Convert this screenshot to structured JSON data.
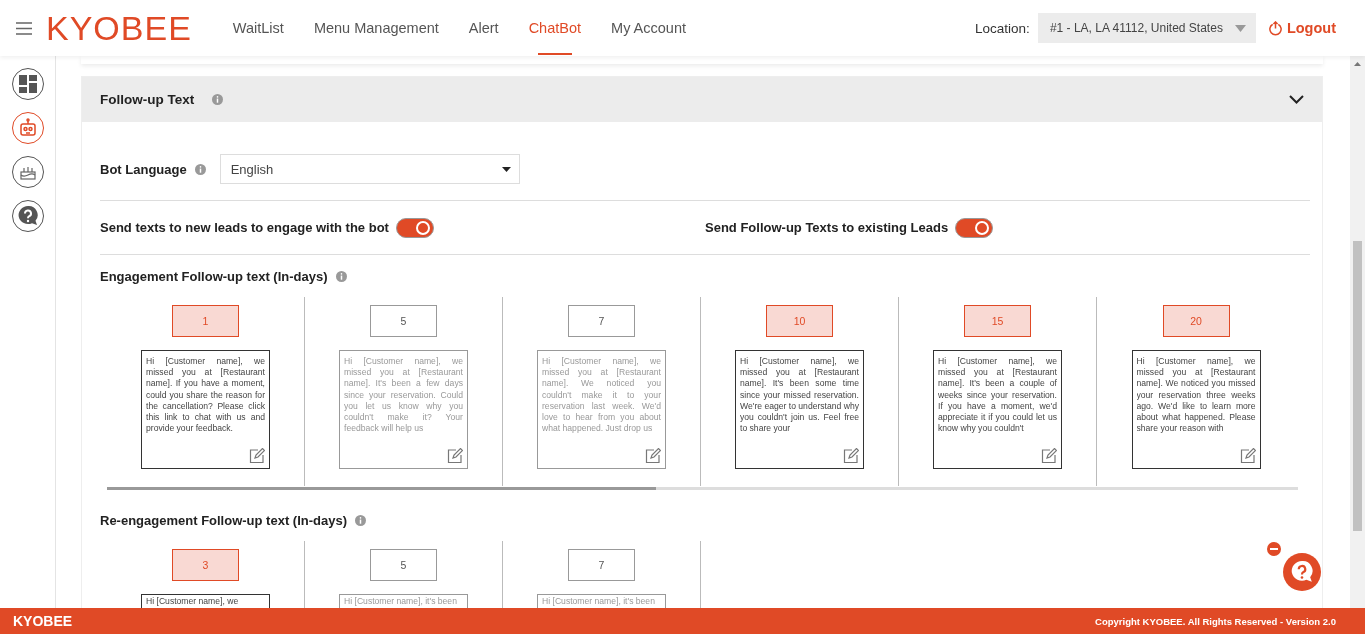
{
  "nav": {
    "logo": "KYOBEE",
    "items": [
      {
        "label": "WaitList",
        "selected": false
      },
      {
        "label": "Menu Management",
        "selected": false
      },
      {
        "label": "Alert",
        "selected": false
      },
      {
        "label": "ChatBot",
        "selected": true
      },
      {
        "label": "My Account",
        "selected": false
      }
    ],
    "location_label": "Location:",
    "location_value": "#1 - LA, LA 41112, United States",
    "logout": "Logout"
  },
  "sidebar": [
    {
      "kind": "dashboard",
      "selected": false
    },
    {
      "kind": "bot",
      "selected": true
    },
    {
      "kind": "cake",
      "selected": false
    },
    {
      "kind": "help",
      "selected": false
    }
  ],
  "panel": {
    "title": "Follow-up Text",
    "expanded": true,
    "bot_language_label": "Bot Language",
    "bot_language": "English",
    "toggles": [
      {
        "label": "Send texts to new leads to engage with the bot",
        "on": true
      },
      {
        "label": "Send Follow-up Texts to existing Leads",
        "on": true
      }
    ],
    "sections": [
      {
        "title": "Engagement Follow-up text (In-days)",
        "items": [
          {
            "day": "1",
            "active": true,
            "message": "Hi [Customer name], we missed you at [Restaurant name]. If you have a moment, could you share the reason for the cancellation? Please click this link to chat with us and provide your feedback."
          },
          {
            "day": "5",
            "active": false,
            "message": "Hi [Customer name], we missed you at [Restaurant name]. It's been a few days since your reservation. Could you let us know why you couldn't make it? Your feedback will help us"
          },
          {
            "day": "7",
            "active": false,
            "message": "Hi [Customer name], we missed you at [Restaurant name]. We noticed you couldn't make it to your reservation last week. We'd love to hear from you about what happened. Just drop us"
          },
          {
            "day": "10",
            "active": true,
            "message": "Hi [Customer name], we missed you at [Restaurant name]. It's been some time since your missed reservation. We're eager to understand why you couldn't join us. Feel free to share your"
          },
          {
            "day": "15",
            "active": true,
            "message": "Hi [Customer name], we missed you at [Restaurant name]. It's been a couple of weeks since your reservation. If you have a moment, we'd appreciate it if you could let us know why you couldn't"
          },
          {
            "day": "20",
            "active": true,
            "message": "Hi [Customer name], we missed you at [Restaurant name]. We noticed you missed your reservation three weeks ago. We'd like to learn more about what happened. Please share your reason with"
          }
        ]
      },
      {
        "title": "Re-engagement Follow-up text (In-days)",
        "items": [
          {
            "day": "3",
            "active": true,
            "message": "Hi [Customer name], we"
          },
          {
            "day": "5",
            "active": false,
            "message": "Hi [Customer name], it's been"
          },
          {
            "day": "7",
            "active": false,
            "message": "Hi [Customer name], it's been"
          }
        ]
      }
    ]
  },
  "footer": {
    "brand": "KYOBEE",
    "copyright": "Copyright KYOBEE. All Rights Reserved - Version 2.0"
  }
}
